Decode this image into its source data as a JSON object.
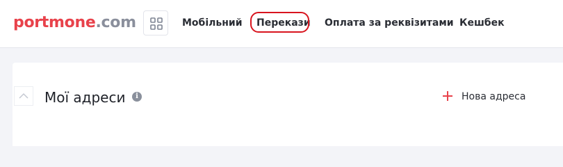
{
  "header": {
    "logo": {
      "brand": "portmone",
      "tld": ".com"
    },
    "apps_button_icon": "grid-icon",
    "nav": {
      "mobile": "Мобільний",
      "transfers": "Перекази",
      "requisites": "Оплата за реквізитами",
      "cashback": "Кешбек"
    },
    "highlighted_item": "transfers"
  },
  "main": {
    "collapse_icon": "chevron-up-icon",
    "title": "Мої адреси",
    "info_icon": "info-icon",
    "info_glyph": "i",
    "add_address_label": "Нова адреса",
    "add_icon": "plus-icon"
  },
  "colors": {
    "brand": "#e8424b",
    "tld": "#8a8f9c",
    "highlight_ring": "#d8141e",
    "page_background": "#f3f4f8",
    "text": "#2a2d34"
  }
}
